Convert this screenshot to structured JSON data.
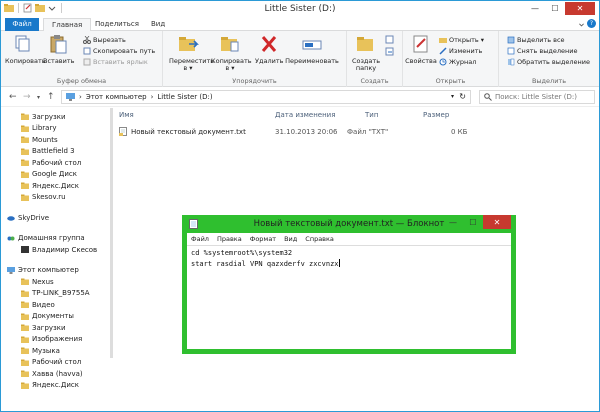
{
  "window": {
    "title": "Little Sister (D:)"
  },
  "tabs": [
    "Файл",
    "Главная",
    "Поделиться",
    "Вид"
  ],
  "ribbon": {
    "clipboard": {
      "copy": "Копировать",
      "paste": "Вставить",
      "cut": "Вырезать",
      "copy_path": "Скопировать путь",
      "paste_shortcut": "Вставить ярлык",
      "label": "Буфер обмена"
    },
    "organize": {
      "move_l1": "Переместить",
      "move_l2": "в ▾",
      "copyto_l1": "Копировать",
      "copyto_l2": "в ▾",
      "delete": "Удалить",
      "rename": "Переименовать",
      "label": "Упорядочить"
    },
    "create": {
      "new_l1": "Создать",
      "new_l2": "папку",
      "label": "Создать"
    },
    "open": {
      "properties": "Свойства",
      "open": "Открыть ▾",
      "edit": "Изменить",
      "history": "Журнал",
      "label": "Открыть"
    },
    "select": {
      "select_all": "Выделить все",
      "select_none": "Снять выделение",
      "invert": "Обратить выделение",
      "label": "Выделить"
    }
  },
  "address": {
    "path_root": "Этот компьютер",
    "path_current": "Little Sister (D:)",
    "search_placeholder": "Поиск: Little Sister (D:)"
  },
  "nav": {
    "favorites": [
      "Загрузки",
      "Library",
      "Mounts",
      "Battlefield 3",
      "Рабочий стол",
      "Google Диск",
      "Яндекс.Диск",
      "Skesov.ru"
    ],
    "skydrive": "SkyDrive",
    "homegroup": "Домашняя группа",
    "homegroup_user": "Владимир Скесов",
    "computer": "Этот компьютер",
    "computer_items": [
      "Nexus",
      "TP-LINK_B9755A",
      "Видео",
      "Документы",
      "Загрузки",
      "Изображения",
      "Музыка",
      "Рабочий стол",
      "Хавва (havva)",
      "Яндекс.Диск"
    ]
  },
  "columns": {
    "name": "Имя",
    "date": "Дата изменения",
    "type": "Тип",
    "size": "Размер"
  },
  "files": [
    {
      "name": "Новый текстовый документ.txt",
      "date": "31.10.2013 20:06",
      "type": "Файл \"TXT\"",
      "size": "0 КБ"
    }
  ],
  "notepad": {
    "title": "Новый текстовый документ.txt — Блокнот",
    "menu": [
      "Файл",
      "Правка",
      "Формат",
      "Вид",
      "Справка"
    ],
    "line1": "cd %systemroot%\\system32",
    "line2": "start rasdial VPN qazxderfv zxcvnzx"
  }
}
